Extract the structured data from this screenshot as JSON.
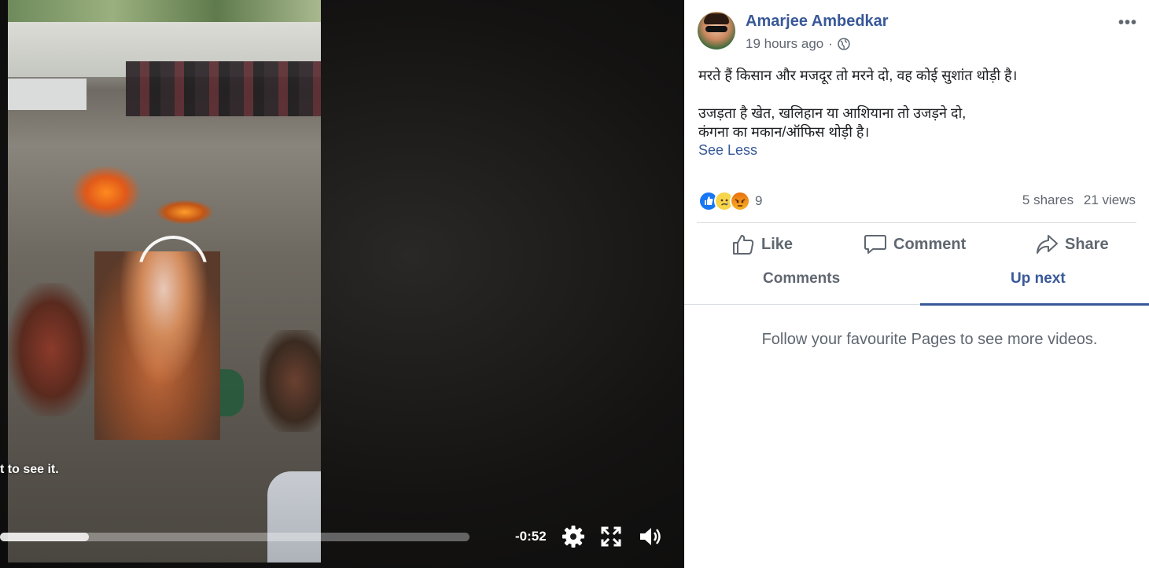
{
  "video": {
    "overlay_text": "t to see it.",
    "time_remaining": "-0:52",
    "progress": 0.19,
    "settings_icon": "gear-icon",
    "fullscreen_icon": "fullscreen-icon",
    "volume_icon": "volume-icon"
  },
  "post": {
    "author": "Amarjee Ambedkar",
    "timestamp": "19 hours ago",
    "separator": "·",
    "privacy_icon": "globe-icon",
    "more_label": "•••",
    "text_line1": "मरते हैं किसान और मजदूर तो मरने दो, वह कोई सुशांत थोड़ी है।",
    "text_line2": "उजड़ता है खेत, खलिहान या आशियाना तो उजड़ने दो,",
    "text_line3": "कंगना का मकान/ऑफिस थोड़ी है।",
    "see_less": "See Less"
  },
  "engagement": {
    "reaction_icons": [
      "like-reaction-icon",
      "sad-reaction-icon",
      "angry-reaction-icon"
    ],
    "reaction_count": "9",
    "shares": "5 shares",
    "views": "21 views"
  },
  "actions": {
    "like": "Like",
    "comment": "Comment",
    "share": "Share"
  },
  "tabs": {
    "comments": "Comments",
    "up_next": "Up next"
  },
  "up_next": {
    "empty_message": "Follow your favourite Pages to see more videos."
  },
  "colors": {
    "link": "#385898",
    "secondary_text": "#606770",
    "like_blue": "#1877f2"
  }
}
